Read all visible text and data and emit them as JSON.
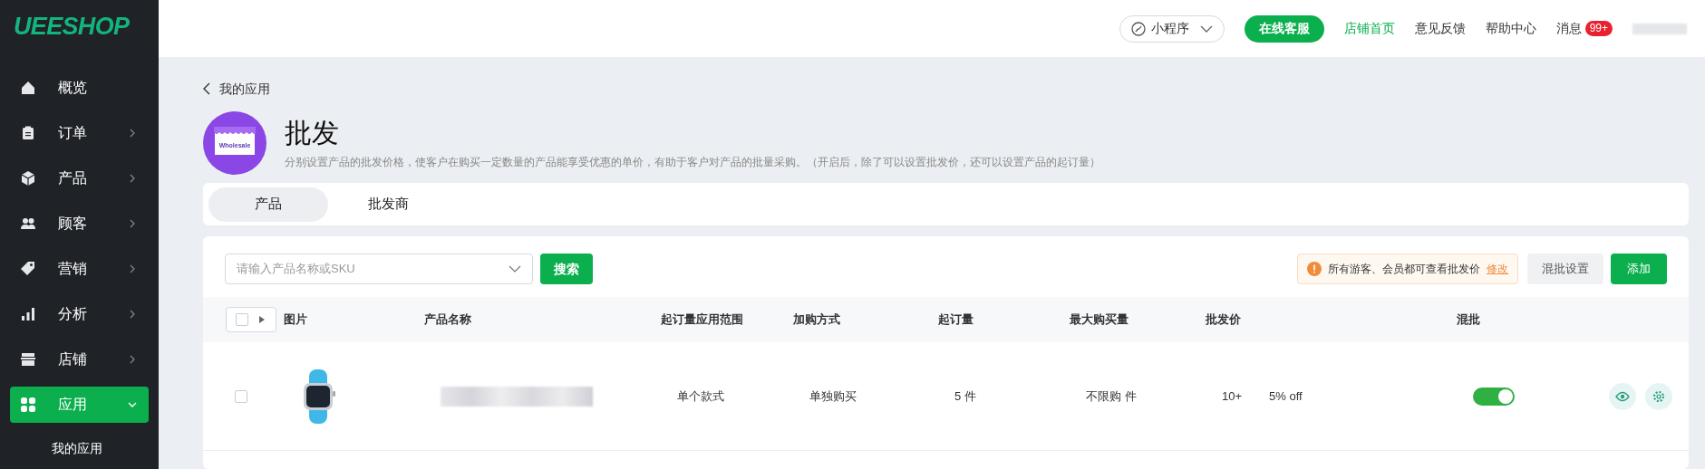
{
  "logo": "UEESHOP",
  "sidebar": {
    "items": [
      {
        "label": "概览",
        "expandable": false,
        "selected": false
      },
      {
        "label": "订单",
        "expandable": true,
        "expanded": false,
        "selected": false
      },
      {
        "label": "产品",
        "expandable": true,
        "expanded": false,
        "selected": false
      },
      {
        "label": "顾客",
        "expandable": true,
        "expanded": false,
        "selected": false
      },
      {
        "label": "营销",
        "expandable": true,
        "expanded": false,
        "selected": false
      },
      {
        "label": "分析",
        "expandable": true,
        "expanded": false,
        "selected": false
      },
      {
        "label": "店铺",
        "expandable": true,
        "expanded": false,
        "selected": false
      },
      {
        "label": "应用",
        "expandable": true,
        "expanded": true,
        "selected": true,
        "children": [
          {
            "label": "我的应用"
          }
        ]
      }
    ]
  },
  "header": {
    "mini_program": "小程序",
    "service_button": "在线客服",
    "links": [
      {
        "label": "店铺首页",
        "selected": true
      },
      {
        "label": "意见反馈",
        "selected": false
      },
      {
        "label": "帮助中心",
        "selected": false
      }
    ],
    "messages": {
      "label": "消息",
      "badge": "99+"
    }
  },
  "breadcrumb": "我的应用",
  "app": {
    "title": "批发",
    "icon_text": "Wholesale",
    "description": "分别设置产品的批发价格，使客户在购买一定数量的产品能享受优惠的单价，有助于客户对产品的批量采购。（开启后，除了可以设置批发价，还可以设置产品的起订量）"
  },
  "tabs": [
    {
      "label": "产品",
      "selected": true
    },
    {
      "label": "批发商",
      "selected": false
    }
  ],
  "toolbar": {
    "search": {
      "placeholder": "请输入产品名称或SKU"
    },
    "search_button": "搜索",
    "notice": "所有游客、会员都可查看批发价",
    "notice_link": "修改",
    "mix_settings_button": "混批设置",
    "add_button": "添加"
  },
  "table": {
    "select_all": false,
    "columns": [
      "图片",
      "产品名称",
      "起订量应用范围",
      "加购方式",
      "起订量",
      "最大购买量",
      "批发价",
      "混批"
    ],
    "rows": [
      {
        "checked": false,
        "scope": "单个款式",
        "method": "单独购买",
        "min_qty": "5 件",
        "max_qty": "不限购 件",
        "tier": "10+",
        "discount": "5% off",
        "mixed": true
      }
    ]
  }
}
